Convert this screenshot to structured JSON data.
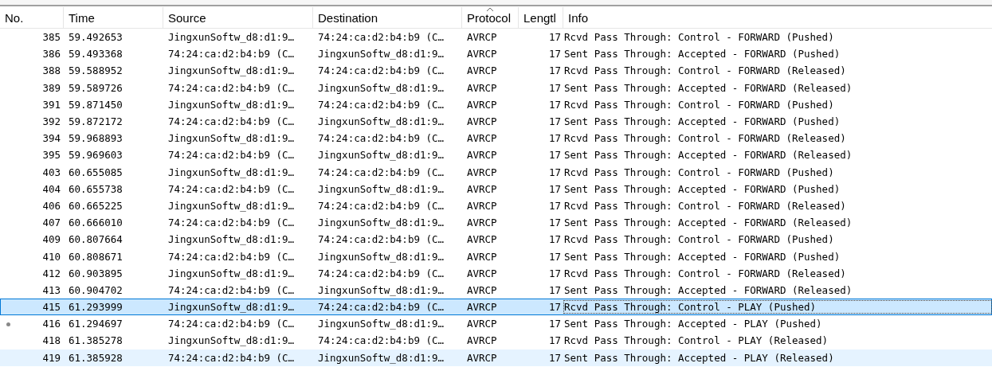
{
  "table": {
    "columns": [
      {
        "label": "No.",
        "sorted": false
      },
      {
        "label": "Time",
        "sorted": false
      },
      {
        "label": "Source",
        "sorted": false
      },
      {
        "label": "Destination",
        "sorted": false
      },
      {
        "label": "Protocol",
        "sorted": true
      },
      {
        "label": "Lengtl",
        "sorted": false
      },
      {
        "label": "Info",
        "sorted": false
      }
    ],
    "rows": [
      {
        "no": "385",
        "time": "59.492653",
        "source": "JingxunSoftw_d8:d1:9…",
        "destination": "74:24:ca:d2:b4:b9 (C…",
        "protocol": "AVRCP",
        "length": "17",
        "info": "Rcvd Pass Through: Control - FORWARD (Pushed)",
        "selected": false,
        "highlighted": false,
        "related": false
      },
      {
        "no": "386",
        "time": "59.493368",
        "source": "74:24:ca:d2:b4:b9 (C…",
        "destination": "JingxunSoftw_d8:d1:9…",
        "protocol": "AVRCP",
        "length": "17",
        "info": "Sent Pass Through: Accepted - FORWARD (Pushed)",
        "selected": false,
        "highlighted": false,
        "related": false
      },
      {
        "no": "388",
        "time": "59.588952",
        "source": "JingxunSoftw_d8:d1:9…",
        "destination": "74:24:ca:d2:b4:b9 (C…",
        "protocol": "AVRCP",
        "length": "17",
        "info": "Rcvd Pass Through: Control - FORWARD (Released)",
        "selected": false,
        "highlighted": false,
        "related": false
      },
      {
        "no": "389",
        "time": "59.589726",
        "source": "74:24:ca:d2:b4:b9 (C…",
        "destination": "JingxunSoftw_d8:d1:9…",
        "protocol": "AVRCP",
        "length": "17",
        "info": "Sent Pass Through: Accepted - FORWARD (Released)",
        "selected": false,
        "highlighted": false,
        "related": false
      },
      {
        "no": "391",
        "time": "59.871450",
        "source": "JingxunSoftw_d8:d1:9…",
        "destination": "74:24:ca:d2:b4:b9 (C…",
        "protocol": "AVRCP",
        "length": "17",
        "info": "Rcvd Pass Through: Control - FORWARD (Pushed)",
        "selected": false,
        "highlighted": false,
        "related": false
      },
      {
        "no": "392",
        "time": "59.872172",
        "source": "74:24:ca:d2:b4:b9 (C…",
        "destination": "JingxunSoftw_d8:d1:9…",
        "protocol": "AVRCP",
        "length": "17",
        "info": "Sent Pass Through: Accepted - FORWARD (Pushed)",
        "selected": false,
        "highlighted": false,
        "related": false
      },
      {
        "no": "394",
        "time": "59.968893",
        "source": "JingxunSoftw_d8:d1:9…",
        "destination": "74:24:ca:d2:b4:b9 (C…",
        "protocol": "AVRCP",
        "length": "17",
        "info": "Rcvd Pass Through: Control - FORWARD (Released)",
        "selected": false,
        "highlighted": false,
        "related": false
      },
      {
        "no": "395",
        "time": "59.969603",
        "source": "74:24:ca:d2:b4:b9 (C…",
        "destination": "JingxunSoftw_d8:d1:9…",
        "protocol": "AVRCP",
        "length": "17",
        "info": "Sent Pass Through: Accepted - FORWARD (Released)",
        "selected": false,
        "highlighted": false,
        "related": false
      },
      {
        "no": "403",
        "time": "60.655085",
        "source": "JingxunSoftw_d8:d1:9…",
        "destination": "74:24:ca:d2:b4:b9 (C…",
        "protocol": "AVRCP",
        "length": "17",
        "info": "Rcvd Pass Through: Control - FORWARD (Pushed)",
        "selected": false,
        "highlighted": false,
        "related": false
      },
      {
        "no": "404",
        "time": "60.655738",
        "source": "74:24:ca:d2:b4:b9 (C…",
        "destination": "JingxunSoftw_d8:d1:9…",
        "protocol": "AVRCP",
        "length": "17",
        "info": "Sent Pass Through: Accepted - FORWARD (Pushed)",
        "selected": false,
        "highlighted": false,
        "related": false
      },
      {
        "no": "406",
        "time": "60.665225",
        "source": "JingxunSoftw_d8:d1:9…",
        "destination": "74:24:ca:d2:b4:b9 (C…",
        "protocol": "AVRCP",
        "length": "17",
        "info": "Rcvd Pass Through: Control - FORWARD (Released)",
        "selected": false,
        "highlighted": false,
        "related": false
      },
      {
        "no": "407",
        "time": "60.666010",
        "source": "74:24:ca:d2:b4:b9 (C…",
        "destination": "JingxunSoftw_d8:d1:9…",
        "protocol": "AVRCP",
        "length": "17",
        "info": "Sent Pass Through: Accepted - FORWARD (Released)",
        "selected": false,
        "highlighted": false,
        "related": false
      },
      {
        "no": "409",
        "time": "60.807664",
        "source": "JingxunSoftw_d8:d1:9…",
        "destination": "74:24:ca:d2:b4:b9 (C…",
        "protocol": "AVRCP",
        "length": "17",
        "info": "Rcvd Pass Through: Control - FORWARD (Pushed)",
        "selected": false,
        "highlighted": false,
        "related": false
      },
      {
        "no": "410",
        "time": "60.808671",
        "source": "74:24:ca:d2:b4:b9 (C…",
        "destination": "JingxunSoftw_d8:d1:9…",
        "protocol": "AVRCP",
        "length": "17",
        "info": "Sent Pass Through: Accepted - FORWARD (Pushed)",
        "selected": false,
        "highlighted": false,
        "related": false
      },
      {
        "no": "412",
        "time": "60.903895",
        "source": "JingxunSoftw_d8:d1:9…",
        "destination": "74:24:ca:d2:b4:b9 (C…",
        "protocol": "AVRCP",
        "length": "17",
        "info": "Rcvd Pass Through: Control - FORWARD (Released)",
        "selected": false,
        "highlighted": false,
        "related": false
      },
      {
        "no": "413",
        "time": "60.904702",
        "source": "74:24:ca:d2:b4:b9 (C…",
        "destination": "JingxunSoftw_d8:d1:9…",
        "protocol": "AVRCP",
        "length": "17",
        "info": "Sent Pass Through: Accepted - FORWARD (Released)",
        "selected": false,
        "highlighted": false,
        "related": false
      },
      {
        "no": "415",
        "time": "61.293999",
        "source": "JingxunSoftw_d8:d1:9…",
        "destination": "74:24:ca:d2:b4:b9 (C…",
        "protocol": "AVRCP",
        "length": "17",
        "info": "Rcvd Pass Through: Control - PLAY (Pushed)",
        "selected": true,
        "highlighted": false,
        "related": false
      },
      {
        "no": "416",
        "time": "61.294697",
        "source": "74:24:ca:d2:b4:b9 (C…",
        "destination": "JingxunSoftw_d8:d1:9…",
        "protocol": "AVRCP",
        "length": "17",
        "info": "Sent Pass Through: Accepted - PLAY (Pushed)",
        "selected": false,
        "highlighted": false,
        "related": true
      },
      {
        "no": "418",
        "time": "61.385278",
        "source": "JingxunSoftw_d8:d1:9…",
        "destination": "74:24:ca:d2:b4:b9 (C…",
        "protocol": "AVRCP",
        "length": "17",
        "info": "Rcvd Pass Through: Control - PLAY (Released)",
        "selected": false,
        "highlighted": false,
        "related": false
      },
      {
        "no": "419",
        "time": "61.385928",
        "source": "74:24:ca:d2:b4:b9 (C…",
        "destination": "JingxunSoftw_d8:d1:9…",
        "protocol": "AVRCP",
        "length": "17",
        "info": "Sent Pass Through: Accepted - PLAY (Released)",
        "selected": false,
        "highlighted": true,
        "related": false
      }
    ]
  }
}
